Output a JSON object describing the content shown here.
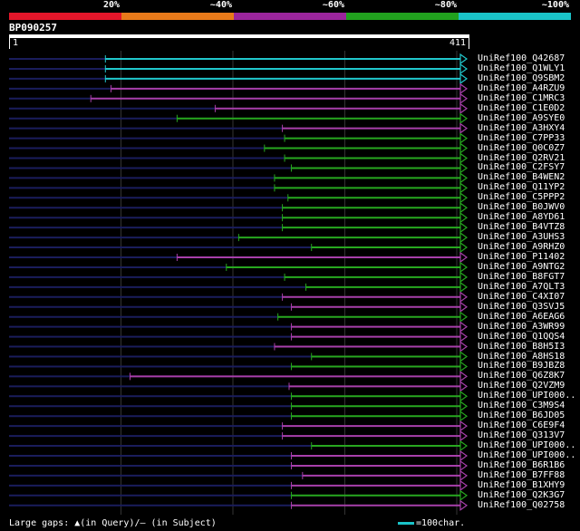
{
  "scale": {
    "segments": [
      {
        "color": "#e3162a",
        "label": "20%"
      },
      {
        "color": "#e87a1a",
        "label": "~40%"
      },
      {
        "color": "#9b259c",
        "label": "~60%"
      },
      {
        "color": "#21a11e",
        "label": "~80%"
      },
      {
        "color": "#1ac3c8",
        "label": "~100%"
      }
    ]
  },
  "query": {
    "id": "BP090257",
    "start": "1",
    "end": "411"
  },
  "colors": {
    "cyan": "#20c7cc",
    "purple": "#a83fab",
    "green": "#27a81f",
    "unaligned": "#1a1d5c",
    "gridline": "#333333"
  },
  "hits": [
    {
      "name": "UniRef100_Q42687",
      "color": "cyan",
      "start": 86
    },
    {
      "name": "UniRef100_Q1WLY1",
      "color": "cyan",
      "start": 86
    },
    {
      "name": "UniRef100_Q9SBM2",
      "color": "cyan",
      "start": 86
    },
    {
      "name": "UniRef100_A4RZU9",
      "color": "purple",
      "start": 91
    },
    {
      "name": "UniRef100_C1MRC3",
      "color": "purple",
      "start": 73
    },
    {
      "name": "UniRef100_C1E0D2",
      "color": "purple",
      "start": 184
    },
    {
      "name": "UniRef100_A9SYE0",
      "color": "green",
      "start": 150
    },
    {
      "name": "UniRef100_A3HXY4",
      "color": "purple",
      "start": 244
    },
    {
      "name": "UniRef100_C7PP33",
      "color": "green",
      "start": 246
    },
    {
      "name": "UniRef100_Q0C0Z7",
      "color": "green",
      "start": 228
    },
    {
      "name": "UniRef100_Q2RV21",
      "color": "green",
      "start": 246
    },
    {
      "name": "UniRef100_C2FSY7",
      "color": "green",
      "start": 252
    },
    {
      "name": "UniRef100_B4WEN2",
      "color": "green",
      "start": 237
    },
    {
      "name": "UniRef100_Q11YP2",
      "color": "green",
      "start": 237
    },
    {
      "name": "UniRef100_C5PPP2",
      "color": "green",
      "start": 249
    },
    {
      "name": "UniRef100_B0JWV0",
      "color": "green",
      "start": 244
    },
    {
      "name": "UniRef100_A8YD61",
      "color": "green",
      "start": 244
    },
    {
      "name": "UniRef100_B4VTZ8",
      "color": "green",
      "start": 244
    },
    {
      "name": "UniRef100_A3UHS3",
      "color": "green",
      "start": 205
    },
    {
      "name": "UniRef100_A9RHZ0",
      "color": "green",
      "start": 270
    },
    {
      "name": "UniRef100_P11402",
      "color": "purple",
      "start": 150
    },
    {
      "name": "UniRef100_A9NTG2",
      "color": "green",
      "start": 194
    },
    {
      "name": "UniRef100_B8FGT7",
      "color": "green",
      "start": 246
    },
    {
      "name": "UniRef100_A7QLT3",
      "color": "green",
      "start": 265
    },
    {
      "name": "UniRef100_C4XI07",
      "color": "purple",
      "start": 244
    },
    {
      "name": "UniRef100_Q3SVJ5",
      "color": "purple",
      "start": 252
    },
    {
      "name": "UniRef100_A6EAG6",
      "color": "green",
      "start": 240
    },
    {
      "name": "UniRef100_A3WR99",
      "color": "purple",
      "start": 252
    },
    {
      "name": "UniRef100_Q1QQS4",
      "color": "purple",
      "start": 252
    },
    {
      "name": "UniRef100_B8H5I3",
      "color": "purple",
      "start": 237
    },
    {
      "name": "UniRef100_A8HS18",
      "color": "green",
      "start": 270
    },
    {
      "name": "UniRef100_B9JBZ8",
      "color": "green",
      "start": 252
    },
    {
      "name": "UniRef100_Q6Z8K7",
      "color": "purple",
      "start": 108
    },
    {
      "name": "UniRef100_Q2VZM9",
      "color": "purple",
      "start": 250
    },
    {
      "name": "UniRef100_UPI000..",
      "color": "green",
      "start": 252
    },
    {
      "name": "UniRef100_C3M9S4",
      "color": "green",
      "start": 252
    },
    {
      "name": "UniRef100_B6JD05",
      "color": "green",
      "start": 252
    },
    {
      "name": "UniRef100_C6E9F4",
      "color": "purple",
      "start": 244
    },
    {
      "name": "UniRef100_Q313V7",
      "color": "purple",
      "start": 244
    },
    {
      "name": "UniRef100_UPI000..",
      "color": "green",
      "start": 270
    },
    {
      "name": "UniRef100_UPI000..",
      "color": "purple",
      "start": 252
    },
    {
      "name": "UniRef100_B6R1B6",
      "color": "purple",
      "start": 252
    },
    {
      "name": "UniRef100_B7FF88",
      "color": "purple",
      "start": 262
    },
    {
      "name": "UniRef100_B1XHY9",
      "color": "purple",
      "start": 252
    },
    {
      "name": "UniRef100_Q2K3G7",
      "color": "green",
      "start": 252
    },
    {
      "name": "UniRef100_Q02758",
      "color": "purple",
      "start": 252
    }
  ],
  "footer": {
    "gaps_legend": "Large gaps: ▲(in Query)/– (in Subject)",
    "scale_legend": "=100char."
  }
}
